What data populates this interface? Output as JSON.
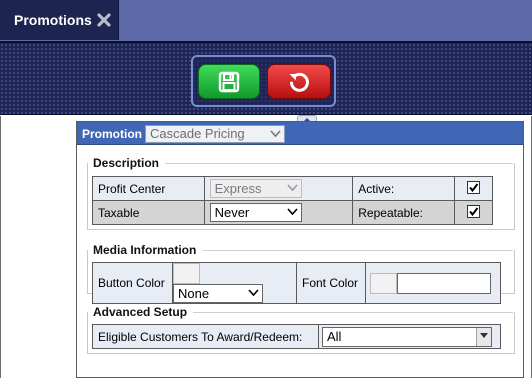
{
  "tab": {
    "label": "Promotions",
    "close_icon": "close-x-icon"
  },
  "toolbar": {
    "save_icon": "floppy-disk-icon",
    "revert_icon": "undo-circle-icon",
    "collapse_icon": "chevron-up-icon"
  },
  "header": {
    "label": "Promotion",
    "selected": "Cascade Pricing"
  },
  "description": {
    "title": "Description",
    "profit_center_label": "Profit Center",
    "profit_center_value": "Express",
    "active_label": "Active:",
    "active_checked": true,
    "taxable_label": "Taxable",
    "taxable_value": "Never",
    "repeatable_label": "Repeatable:",
    "repeatable_checked": true
  },
  "media": {
    "title": "Media Information",
    "button_color_label": "Button Color",
    "button_color_value": "None",
    "font_color_label": "Font Color",
    "font_color_value": ""
  },
  "advanced": {
    "title": "Advanced Setup",
    "eligible_label": "Eligible Customers To Award/Redeem:",
    "eligible_value": "All"
  },
  "colors": {
    "tab_bg": "#1c2550",
    "toolbar_bg": "#1e2554",
    "header_blue": "#4067b6",
    "save_green": "#2bb845",
    "revert_red": "#d92323"
  }
}
